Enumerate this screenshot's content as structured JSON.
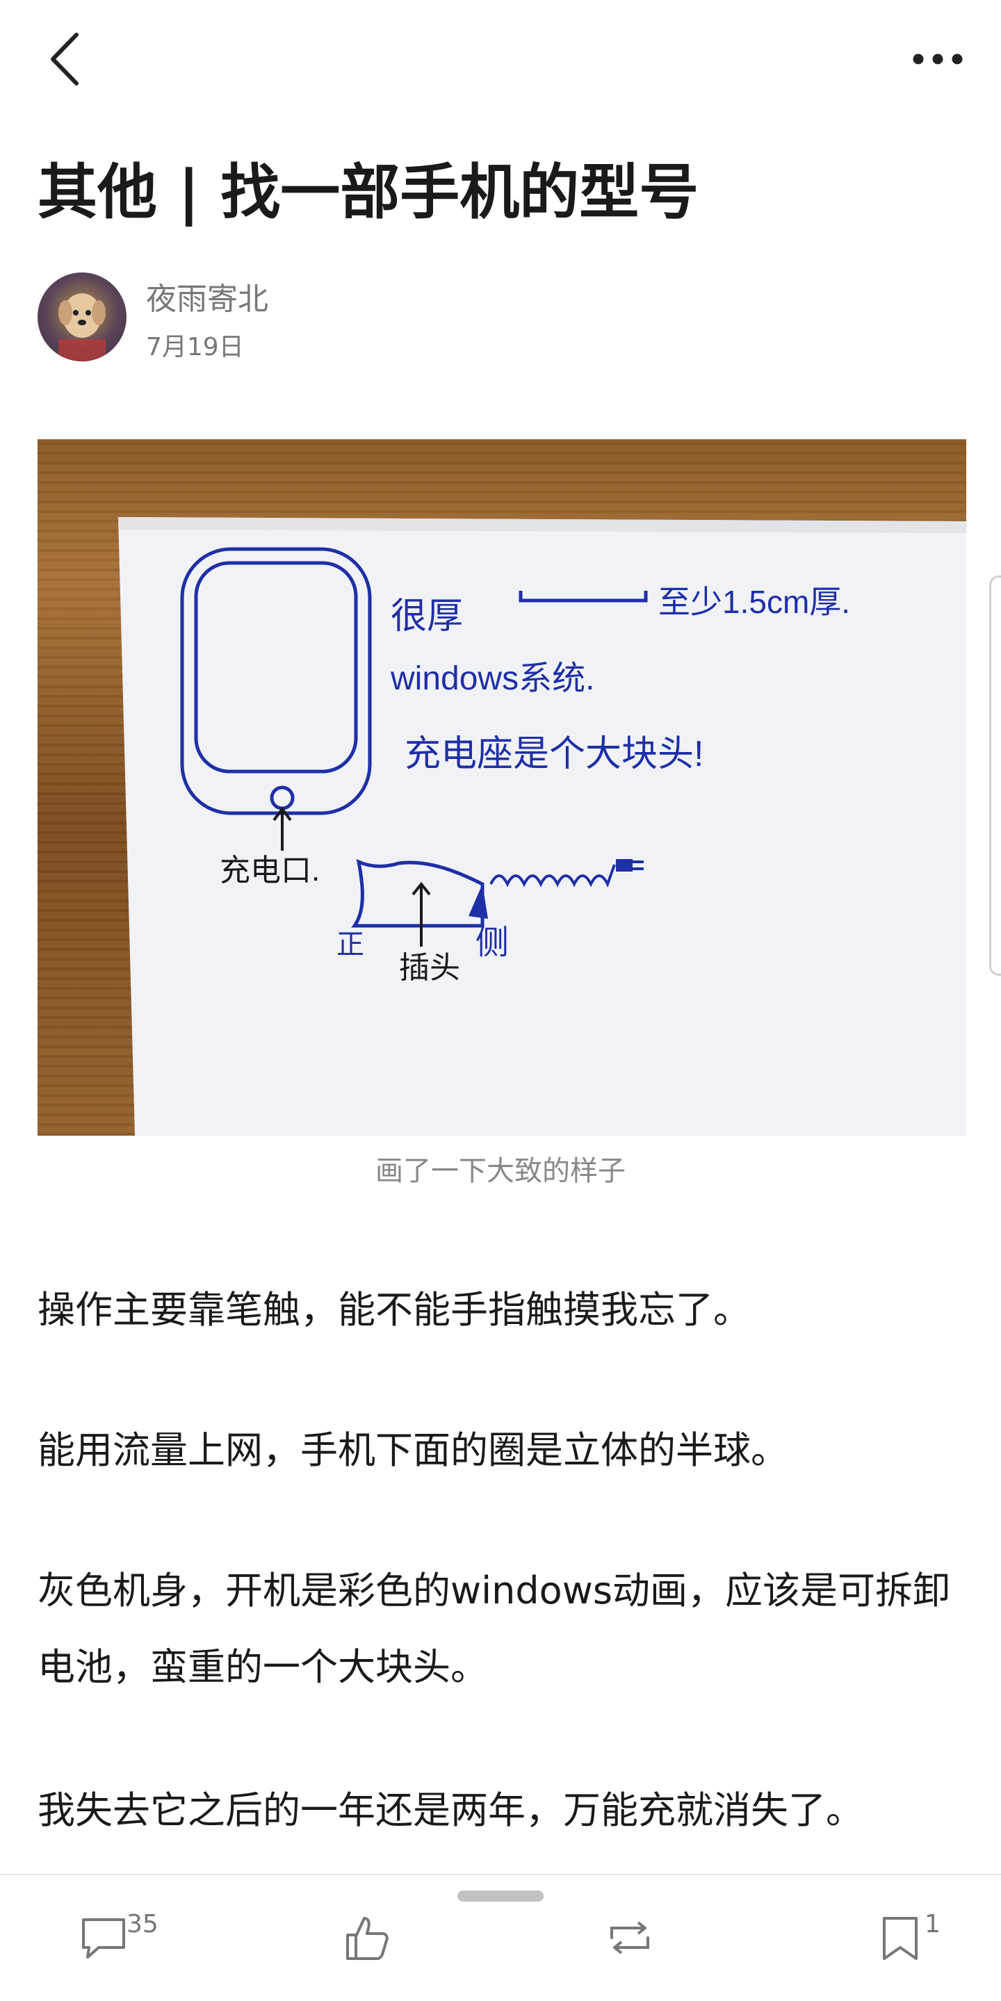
{
  "header": {
    "back_icon": "chevron-left-icon",
    "more_icon": "more-horizontal-icon"
  },
  "article": {
    "title": "其他 | 找一部手机的型号",
    "author": {
      "name": "夜雨寄北",
      "date": "7月19日",
      "avatar_icon": "puppy-avatar"
    },
    "image": {
      "caption": "画了一下大致的样子",
      "handwriting": {
        "thick": "很厚",
        "thickness": "至少1.5cm厚.",
        "system": "windows系统.",
        "charger": "充电座是个大块头!",
        "port_left": "充电口.",
        "front": "正",
        "port_bottom": "插头",
        "side": "侧"
      }
    },
    "paragraphs": [
      "操作主要靠笔触，能不能手指触摸我忘了。",
      "能用流量上网，手机下面的圈是立体的半球。",
      "灰色机身，开机是彩色的windows动画，应该是可拆卸电池，蛮重的一个大块头。",
      "我失去它之后的一年还是两年，万能充就消失了。"
    ]
  },
  "bottom_bar": {
    "comment": {
      "icon": "comment-icon",
      "count": "35"
    },
    "like": {
      "icon": "thumbs-up-icon"
    },
    "repost": {
      "icon": "repost-icon"
    },
    "bookmark": {
      "icon": "bookmark-icon",
      "count": "1"
    }
  },
  "colors": {
    "ink": "#1f2fa6",
    "text": "#1a1a1a",
    "muted": "#777777"
  }
}
